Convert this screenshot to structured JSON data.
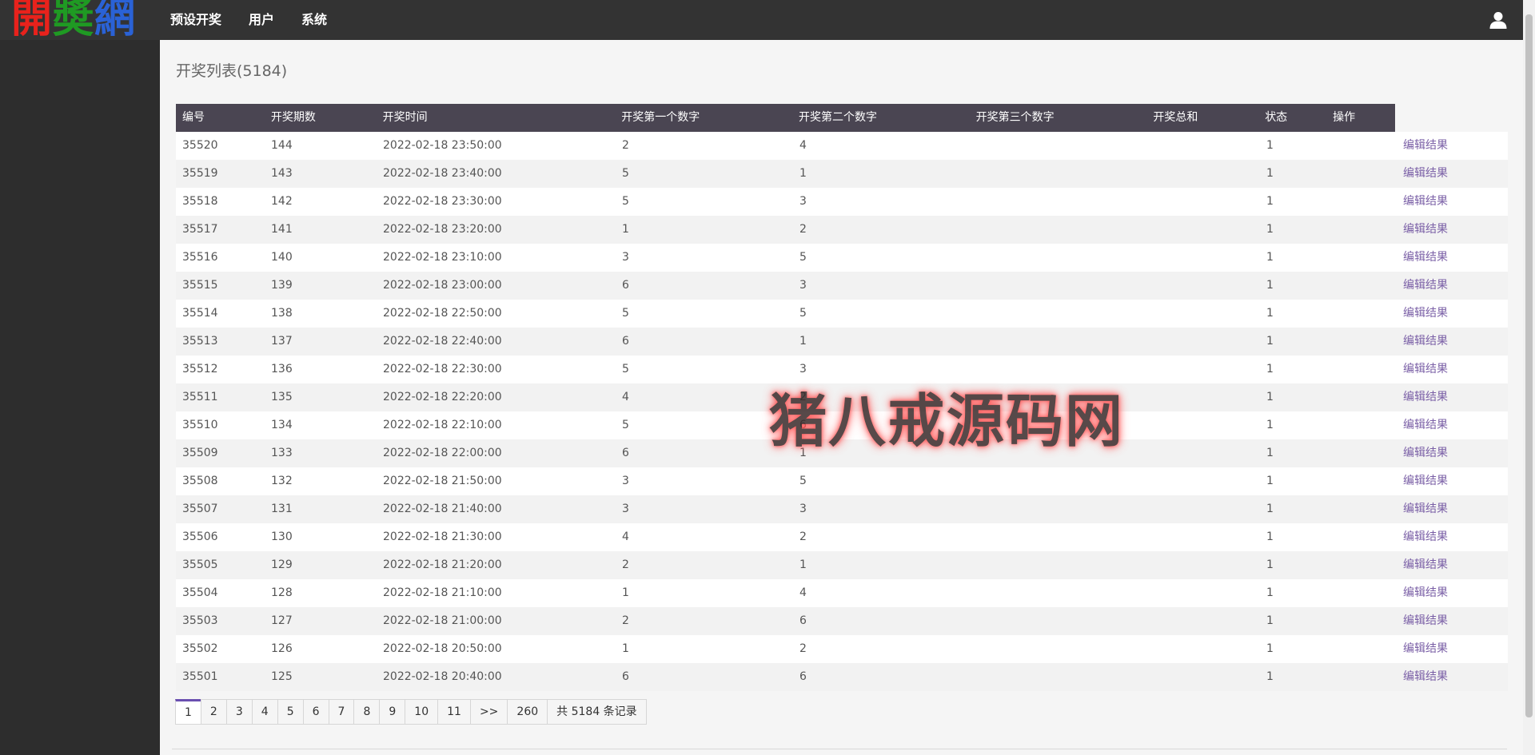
{
  "logo": {
    "chars": [
      "開",
      "奬",
      "網"
    ],
    "colors": [
      "#e8221c",
      "#1f9a23",
      "#2a62d6"
    ]
  },
  "nav": {
    "items": [
      "预设开奖",
      "用户",
      "系统"
    ]
  },
  "page": {
    "title": "开奖列表(5184)"
  },
  "table": {
    "headers": [
      "编号",
      "开奖期数",
      "开奖时间",
      "开奖第一个数字",
      "开奖第二个数字",
      "开奖第三个数字",
      "开奖总和",
      "状态",
      "操作"
    ],
    "action_label": "编辑结果",
    "rows": [
      {
        "id": "35520",
        "period": "144",
        "time": "2022-02-18 23:50:00",
        "n1": "2",
        "n2": "4",
        "n3": "",
        "sum": "",
        "status": "1"
      },
      {
        "id": "35519",
        "period": "143",
        "time": "2022-02-18 23:40:00",
        "n1": "5",
        "n2": "1",
        "n3": "",
        "sum": "",
        "status": "1"
      },
      {
        "id": "35518",
        "period": "142",
        "time": "2022-02-18 23:30:00",
        "n1": "5",
        "n2": "3",
        "n3": "",
        "sum": "",
        "status": "1"
      },
      {
        "id": "35517",
        "period": "141",
        "time": "2022-02-18 23:20:00",
        "n1": "1",
        "n2": "2",
        "n3": "",
        "sum": "",
        "status": "1"
      },
      {
        "id": "35516",
        "period": "140",
        "time": "2022-02-18 23:10:00",
        "n1": "3",
        "n2": "5",
        "n3": "",
        "sum": "",
        "status": "1"
      },
      {
        "id": "35515",
        "period": "139",
        "time": "2022-02-18 23:00:00",
        "n1": "6",
        "n2": "3",
        "n3": "",
        "sum": "",
        "status": "1"
      },
      {
        "id": "35514",
        "period": "138",
        "time": "2022-02-18 22:50:00",
        "n1": "5",
        "n2": "5",
        "n3": "",
        "sum": "",
        "status": "1"
      },
      {
        "id": "35513",
        "period": "137",
        "time": "2022-02-18 22:40:00",
        "n1": "6",
        "n2": "1",
        "n3": "",
        "sum": "",
        "status": "1"
      },
      {
        "id": "35512",
        "period": "136",
        "time": "2022-02-18 22:30:00",
        "n1": "5",
        "n2": "3",
        "n3": "",
        "sum": "",
        "status": "1"
      },
      {
        "id": "35511",
        "period": "135",
        "time": "2022-02-18 22:20:00",
        "n1": "4",
        "n2": "2",
        "n3": "",
        "sum": "",
        "status": "1"
      },
      {
        "id": "35510",
        "period": "134",
        "time": "2022-02-18 22:10:00",
        "n1": "5",
        "n2": "6",
        "n3": "",
        "sum": "",
        "status": "1"
      },
      {
        "id": "35509",
        "period": "133",
        "time": "2022-02-18 22:00:00",
        "n1": "6",
        "n2": "1",
        "n3": "",
        "sum": "",
        "status": "1"
      },
      {
        "id": "35508",
        "period": "132",
        "time": "2022-02-18 21:50:00",
        "n1": "3",
        "n2": "5",
        "n3": "",
        "sum": "",
        "status": "1"
      },
      {
        "id": "35507",
        "period": "131",
        "time": "2022-02-18 21:40:00",
        "n1": "3",
        "n2": "3",
        "n3": "",
        "sum": "",
        "status": "1"
      },
      {
        "id": "35506",
        "period": "130",
        "time": "2022-02-18 21:30:00",
        "n1": "4",
        "n2": "2",
        "n3": "",
        "sum": "",
        "status": "1"
      },
      {
        "id": "35505",
        "period": "129",
        "time": "2022-02-18 21:20:00",
        "n1": "2",
        "n2": "1",
        "n3": "",
        "sum": "",
        "status": "1"
      },
      {
        "id": "35504",
        "period": "128",
        "time": "2022-02-18 21:10:00",
        "n1": "1",
        "n2": "4",
        "n3": "",
        "sum": "",
        "status": "1"
      },
      {
        "id": "35503",
        "period": "127",
        "time": "2022-02-18 21:00:00",
        "n1": "2",
        "n2": "6",
        "n3": "",
        "sum": "",
        "status": "1"
      },
      {
        "id": "35502",
        "period": "126",
        "time": "2022-02-18 20:50:00",
        "n1": "1",
        "n2": "2",
        "n3": "",
        "sum": "",
        "status": "1"
      },
      {
        "id": "35501",
        "period": "125",
        "time": "2022-02-18 20:40:00",
        "n1": "6",
        "n2": "6",
        "n3": "",
        "sum": "",
        "status": "1"
      }
    ]
  },
  "pagination": {
    "pages": [
      "1",
      "2",
      "3",
      "4",
      "5",
      "6",
      "7",
      "8",
      "9",
      "10",
      "11"
    ],
    "active": "1",
    "next": ">>",
    "last": "260",
    "info": "共 5184 条记录"
  },
  "watermark": "猪八戒源码网",
  "icons": {
    "user": "user-icon"
  }
}
